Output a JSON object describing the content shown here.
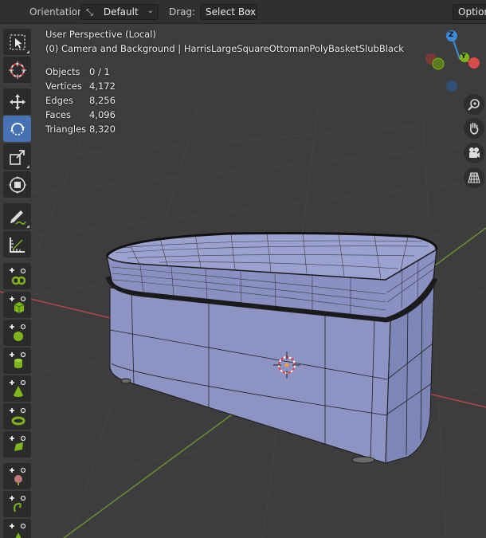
{
  "header": {
    "orientation_label": "Orientation:",
    "orientation_value": "Default",
    "drag_label": "Drag:",
    "drag_value": "Select Box",
    "options_label": "Options"
  },
  "viewport": {
    "view_name": "User Perspective (Local)",
    "collection_info": "(0) Camera and Background | HarrisLargeSquareOttomanPolyBasketSlubBlack",
    "stats": [
      {
        "label": "Objects",
        "value": "0 / 1"
      },
      {
        "label": "Vertices",
        "value": "4,172"
      },
      {
        "label": "Edges",
        "value": "8,256"
      },
      {
        "label": "Faces",
        "value": "4,096"
      },
      {
        "label": "Triangles",
        "value": "8,320"
      }
    ]
  },
  "gizmo": {
    "z_label": "Z",
    "y_label": "Y",
    "colors": {
      "x": "#d94a4a",
      "y": "#7fb51c",
      "z": "#3d8bd8"
    }
  },
  "toolbar": {
    "tools": [
      "select-box",
      "cursor",
      "move",
      "rotate",
      "scale",
      "transform",
      "annotate",
      "measure",
      "add-cube",
      "add-cone",
      "add-cylinder",
      "add-uv-sphere",
      "add-icosphere",
      "add-torus",
      "add-grid",
      "add-monkey",
      "add-cube-2"
    ]
  },
  "colors": {
    "active_tool": "#4772b3",
    "mesh": "#8f96c6",
    "grid_x": "#b5474c",
    "grid_y": "#6b8f32"
  }
}
